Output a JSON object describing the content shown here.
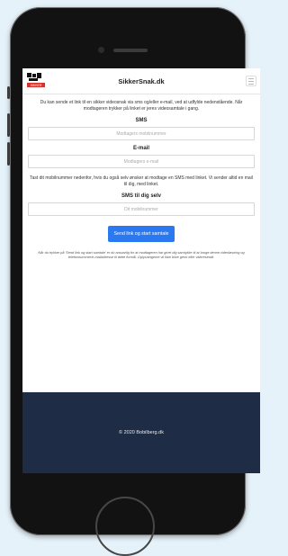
{
  "app": {
    "site_title": "SikkerSnak.dk",
    "logo_caption": "SIKKER"
  },
  "intro": {
    "text": "Du kan sende et link til en sikker videosnak via sms og/eller e-mail, ved at udfylde nedenstående. Når modtageren trykker på linket er jeres videosamtale i gang."
  },
  "sms": {
    "label": "SMS",
    "placeholder": "Modtagers mobilnummer",
    "value": ""
  },
  "email": {
    "label": "E-mail",
    "placeholder": "Modtagers e-mail",
    "value": ""
  },
  "self_info": {
    "text": "Tast dit mobilnummer nedenfor, hvis du også selv ønsker at modtage en SMS med linket. Vi sender altid en mail til dig, med linket."
  },
  "self_sms": {
    "label": "SMS til dig selv",
    "placeholder": "Dit mobilnummer",
    "value": ""
  },
  "actions": {
    "send_label": "Send link og start samtale"
  },
  "disclaimer": {
    "text": "Når du trykker på 'Send link og start samtale' er du ansvarlig for at modtageren har givet dig samtykke til at bruge denne videoløsning og telefonnummer/e-mailadresse til dette formål. Oplysningerne vil ikke blive gemt eller videresendt."
  },
  "footer": {
    "text": "© 2020 Bobilberg.dk"
  },
  "colors": {
    "accent": "#2b79f0",
    "footer_bg": "#1f2c46",
    "page_bg": "#e6f2fa",
    "logo_red": "#d9302c"
  }
}
